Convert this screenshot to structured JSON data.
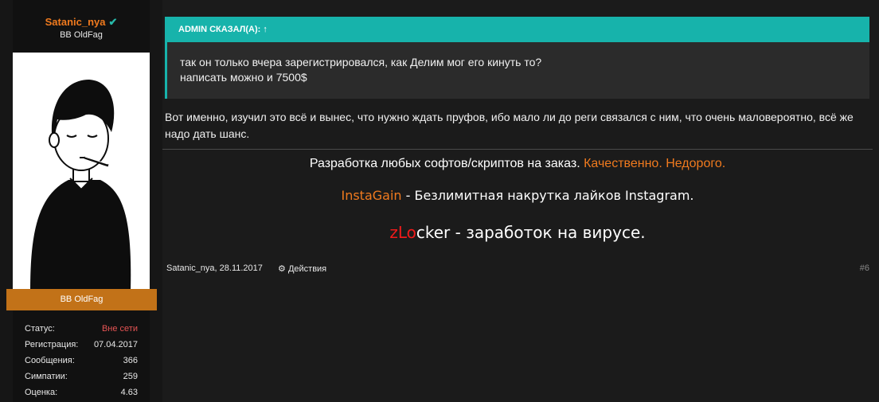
{
  "user": {
    "name": "Satanic_nya",
    "title": "BB OldFag",
    "banner": "BB OldFag",
    "stats": [
      {
        "label": "Статус:",
        "value": "Вне сети"
      },
      {
        "label": "Регистрация:",
        "value": "07.04.2017"
      },
      {
        "label": "Сообщения:",
        "value": "366"
      },
      {
        "label": "Симпатии:",
        "value": "259"
      },
      {
        "label": "Оценка:",
        "value": "4.63"
      }
    ]
  },
  "quote": {
    "header": "ADMIN СКАЗАЛ(А): ↑",
    "line1": "так он только вчера зарегистрировался, как Делим мог его кинуть то?",
    "line2": "написать можно и 7500$"
  },
  "post": {
    "text": "Вот именно, изучил это всё и вынес, что нужно ждать пруфов, ибо мало ли до реги связался с ним, что очень маловероятно, всё же надо дать шанс."
  },
  "signature": {
    "line1_white": "Разработка любых софтов/скриптов на заказ.",
    "line1_orange": "Качественно. Недорого.",
    "line2_orange": "InstaGain",
    "line2_white": " - Безлимитная накрутка лайков Instagram.",
    "line3_red": "zLo",
    "line3_white": "cker - заработок на вирусе."
  },
  "footer": {
    "author_date": "Satanic_nya, 28.11.2017",
    "actions": "Действия",
    "post_number": "#6"
  },
  "colors": {
    "accent": "#17b3ab",
    "username": "#f07a1e",
    "banner": "#c27218",
    "offline": "#e65454"
  }
}
